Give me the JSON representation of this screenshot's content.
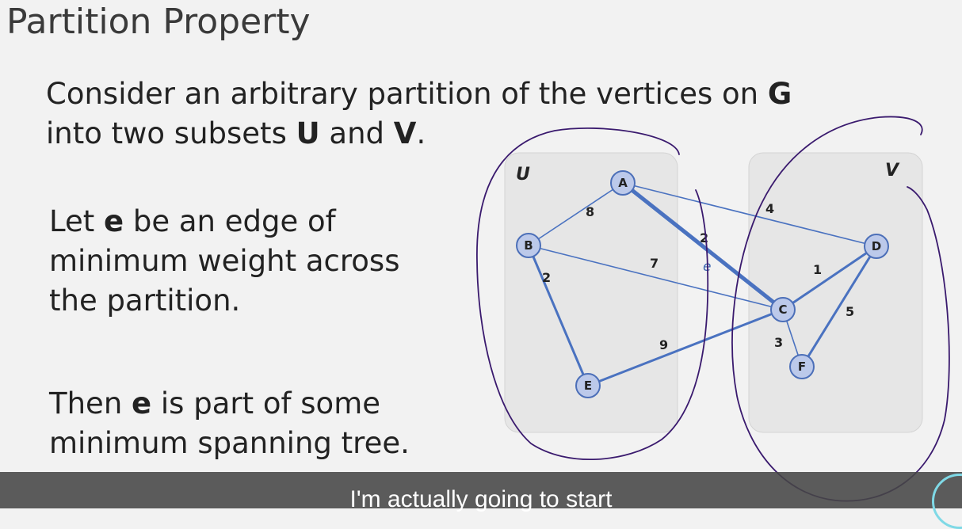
{
  "slide": {
    "title": "Partition Property",
    "p1": {
      "line1_pre": "Consider an arbitrary partition of the vertices on ",
      "line1_bold": "G",
      "line2_pre": "into two subsets ",
      "line2_bold1": "U",
      "line2_mid": " and ",
      "line2_bold2": "V",
      "line2_post": "."
    },
    "p2": {
      "line1_pre": "Let ",
      "line1_bold": "e",
      "line1_post": " be an edge of",
      "line2": "minimum weight across",
      "line3": "the partition."
    },
    "p3": {
      "line1_pre": "Then ",
      "line1_bold": "e",
      "line1_post": " is part of some",
      "line2": "minimum spanning tree."
    }
  },
  "graph": {
    "sets": {
      "left": "U",
      "right": "V"
    },
    "nodes": {
      "A": "A",
      "B": "B",
      "C": "C",
      "D": "D",
      "E": "E",
      "F": "F"
    },
    "weights": {
      "AB": "8",
      "AC": "2",
      "AD": "4",
      "BC": "7",
      "BE": "2",
      "EC": "9",
      "CD": "1",
      "DF": "5",
      "CF": "3"
    },
    "edge_name": "e",
    "colors": {
      "node_fill": "#bcc9ea",
      "node_stroke": "#4c6fb8",
      "edge": "#4a72c0",
      "partition_box": "#e6e6e6",
      "annotation_ink": "#3a1a6e"
    }
  },
  "caption": {
    "text": "I'm actually going to start"
  }
}
